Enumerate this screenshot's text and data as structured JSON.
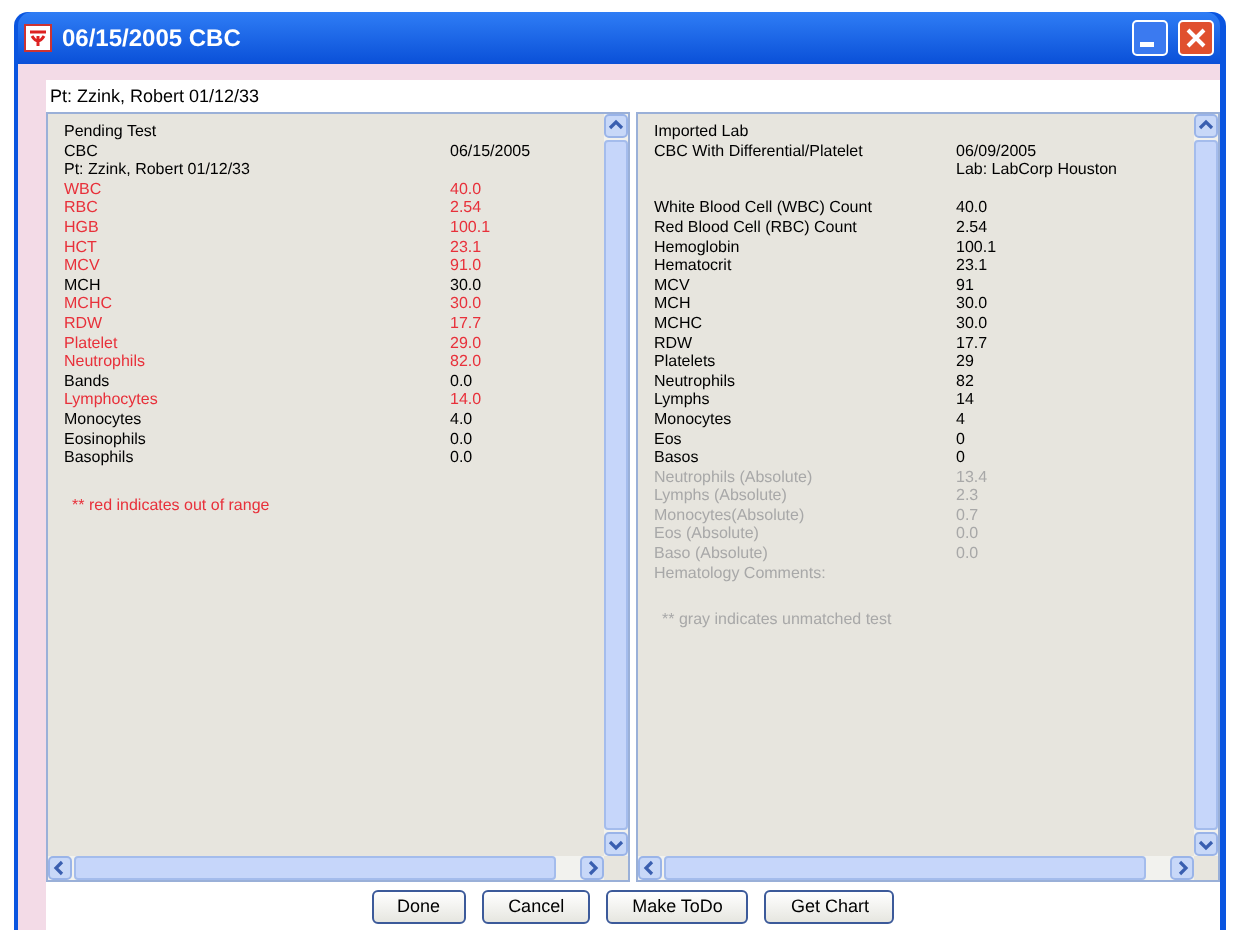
{
  "window": {
    "title": "06/15/2005 CBC"
  },
  "patient": "Pt: Zzink, Robert  01/12/33",
  "pending": {
    "header": [
      {
        "label": "Pending Test"
      },
      {
        "label": "CBC",
        "value": "06/15/2005"
      },
      {
        "label": "Pt: Zzink, Robert  01/12/33"
      }
    ],
    "rows": [
      {
        "label": "WBC",
        "value": "40.0",
        "out_of_range": true
      },
      {
        "label": "RBC",
        "value": "2.54",
        "out_of_range": true
      },
      {
        "label": "HGB",
        "value": "100.1",
        "out_of_range": true
      },
      {
        "label": "HCT",
        "value": "23.1",
        "out_of_range": true
      },
      {
        "label": "MCV",
        "value": "91.0",
        "out_of_range": true
      },
      {
        "label": "MCH",
        "value": "30.0",
        "out_of_range": false
      },
      {
        "label": "MCHC",
        "value": "30.0",
        "out_of_range": true
      },
      {
        "label": "RDW",
        "value": "17.7",
        "out_of_range": true
      },
      {
        "label": "Platelet",
        "value": "29.0",
        "out_of_range": true
      },
      {
        "label": "Neutrophils",
        "value": "82.0",
        "out_of_range": true
      },
      {
        "label": "Bands",
        "value": "0.0",
        "out_of_range": false
      },
      {
        "label": "Lymphocytes",
        "value": "14.0",
        "out_of_range": true
      },
      {
        "label": "Monocytes",
        "value": "4.0",
        "out_of_range": false
      },
      {
        "label": "Eosinophils",
        "value": "0.0",
        "out_of_range": false
      },
      {
        "label": "Basophils",
        "value": "0.0",
        "out_of_range": false
      }
    ],
    "note": "** red indicates out of range"
  },
  "imported": {
    "header": [
      {
        "label": "Imported Lab"
      },
      {
        "label": "CBC With Differential/Platelet",
        "value": "06/09/2005"
      },
      {
        "value": "Lab: LabCorp Houston"
      }
    ],
    "rows": [
      {
        "label": "White Blood Cell (WBC) Count",
        "value": "40.0",
        "matched": true
      },
      {
        "label": "Red Blood Cell (RBC) Count",
        "value": "2.54",
        "matched": true
      },
      {
        "label": "Hemoglobin",
        "value": "100.1",
        "matched": true
      },
      {
        "label": "Hematocrit",
        "value": "23.1",
        "matched": true
      },
      {
        "label": "MCV",
        "value": "91",
        "matched": true
      },
      {
        "label": "MCH",
        "value": "30.0",
        "matched": true
      },
      {
        "label": "MCHC",
        "value": "30.0",
        "matched": true
      },
      {
        "label": "RDW",
        "value": "17.7",
        "matched": true
      },
      {
        "label": "Platelets",
        "value": "29",
        "matched": true
      },
      {
        "label": "Neutrophils",
        "value": "82",
        "matched": true
      },
      {
        "label": "Lymphs",
        "value": "14",
        "matched": true
      },
      {
        "label": "Monocytes",
        "value": "4",
        "matched": true
      },
      {
        "label": "Eos",
        "value": "0",
        "matched": true
      },
      {
        "label": "Basos",
        "value": "0",
        "matched": true
      },
      {
        "label": "Neutrophils (Absolute)",
        "value": "13.4",
        "matched": false
      },
      {
        "label": "Lymphs (Absolute)",
        "value": "2.3",
        "matched": false
      },
      {
        "label": "Monocytes(Absolute)",
        "value": "0.7",
        "matched": false
      },
      {
        "label": "Eos (Absolute)",
        "value": "0.0",
        "matched": false
      },
      {
        "label": "Baso (Absolute)",
        "value": "0.0",
        "matched": false
      },
      {
        "label": "Hematology Comments:",
        "matched": false
      }
    ],
    "note": "** gray indicates unmatched test"
  },
  "buttons": [
    "Done",
    "Cancel",
    "Make ToDo",
    "Get Chart"
  ]
}
